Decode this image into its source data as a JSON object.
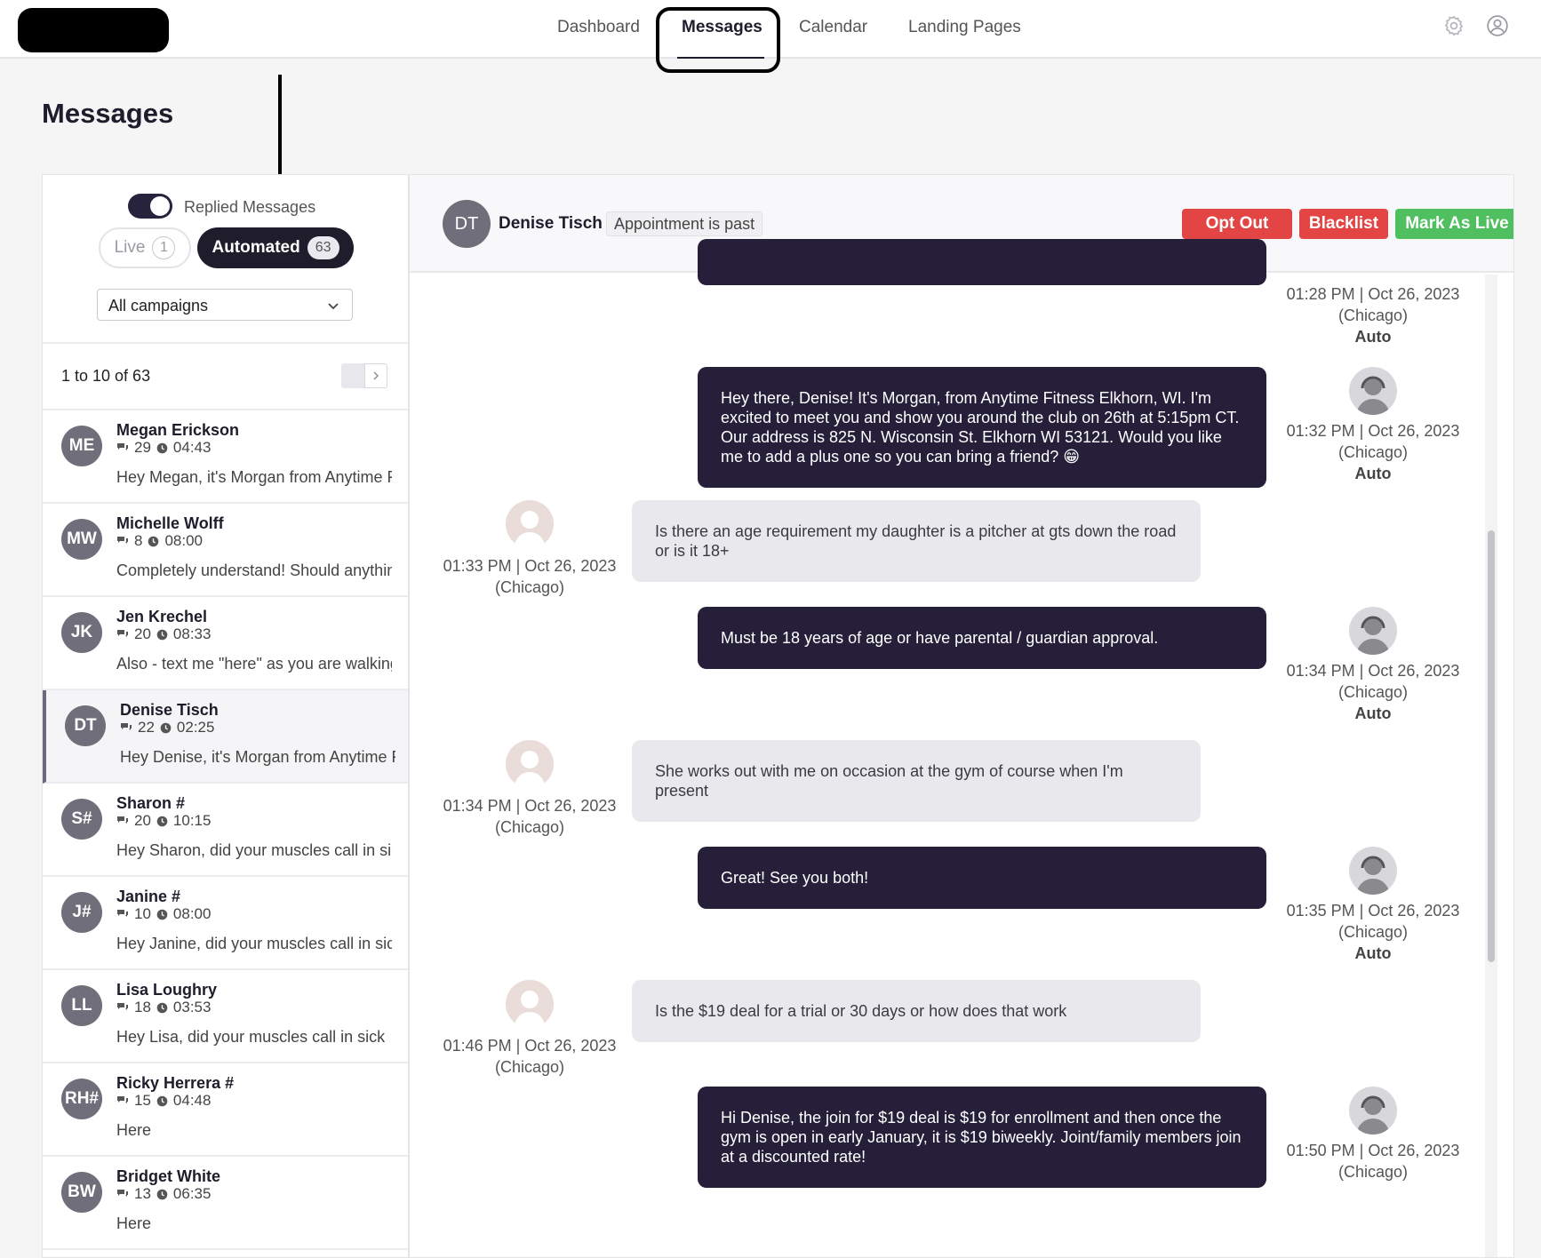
{
  "nav": {
    "items": [
      {
        "label": "Dashboard",
        "active": false
      },
      {
        "label": "Messages",
        "active": true
      },
      {
        "label": "Calendar",
        "active": false
      },
      {
        "label": "Landing Pages",
        "active": false
      }
    ],
    "icons": [
      "gear-icon",
      "user-circle-icon"
    ]
  },
  "page": {
    "title": "Messages"
  },
  "filters": {
    "toggle_label": "Replied Messages",
    "toggle_on": true,
    "live_label": "Live",
    "live_count": "1",
    "automated_label": "Automated",
    "automated_count": "63",
    "campaign_select": "All campaigns"
  },
  "pager": {
    "text": "1 to 10 of 63"
  },
  "conversations": [
    {
      "initials": "ME",
      "name": "Megan Erickson",
      "count": "29",
      "time": "04:43",
      "preview": "Hey Megan, it's Morgan from Anytime Fitness"
    },
    {
      "initials": "MW",
      "name": "Michelle Wolff",
      "count": "8",
      "time": "08:00",
      "preview": "Completely understand! Should anything change"
    },
    {
      "initials": "JK",
      "name": "Jen Krechel",
      "count": "20",
      "time": "08:33",
      "preview": "Also - text me \"here\" as you are walking in"
    },
    {
      "initials": "DT",
      "name": "Denise Tisch",
      "count": "22",
      "time": "02:25",
      "preview": "Hey Denise, it's Morgan from Anytime Fitness",
      "selected": true
    },
    {
      "initials": "S#",
      "name": "Sharon #",
      "count": "20",
      "time": "10:15",
      "preview": "Hey Sharon, did your muscles call in sick"
    },
    {
      "initials": "J#",
      "name": "Janine #",
      "count": "10",
      "time": "08:00",
      "preview": "Hey Janine, did your muscles call in sick"
    },
    {
      "initials": "LL",
      "name": "Lisa Loughry",
      "count": "18",
      "time": "03:53",
      "preview": "Hey Lisa, did your muscles call in sick"
    },
    {
      "initials": "RH#",
      "name": "Ricky Herrera #",
      "count": "15",
      "time": "04:48",
      "preview": "Here"
    },
    {
      "initials": "BW",
      "name": "Bridget White",
      "count": "13",
      "time": "06:35",
      "preview": "Here"
    }
  ],
  "active_conversation": {
    "initials": "DT",
    "name": "Denise Tisch",
    "status": "Appointment is past",
    "actions": {
      "opt_out": "Opt Out",
      "blacklist": "Blacklist",
      "mark_live": "Mark As Live"
    }
  },
  "messages": [
    {
      "dir": "out",
      "text": "",
      "time": "01:28 PM | Oct 26, 2023",
      "tz": "(Chicago)",
      "tag": "Auto"
    },
    {
      "dir": "out",
      "text": "Hey there, Denise! It's Morgan, from Anytime Fitness Elkhorn, WI. I'm excited to meet you and show you around the club on 26th at 5:15pm CT. Our address is 825 N. Wisconsin St. Elkhorn WI 53121. Would you like me to add a plus one so you can bring a friend? 😁",
      "time": "01:32 PM | Oct 26, 2023",
      "tz": "(Chicago)",
      "tag": "Auto"
    },
    {
      "dir": "in",
      "text": "Is there an age requirement my daughter is a pitcher at gts down the road or is it 18+",
      "time": "01:33 PM | Oct 26, 2023",
      "tz": "(Chicago)"
    },
    {
      "dir": "out",
      "text": "Must be 18 years of age or have parental / guardian approval.",
      "time": "01:34 PM | Oct 26, 2023",
      "tz": "(Chicago)",
      "tag": "Auto"
    },
    {
      "dir": "in",
      "text": "She works out with me on occasion at the gym of course when I'm present",
      "time": "01:34 PM | Oct 26, 2023",
      "tz": "(Chicago)"
    },
    {
      "dir": "out",
      "text": "Great! See you both!",
      "time": "01:35 PM | Oct 26, 2023",
      "tz": "(Chicago)",
      "tag": "Auto"
    },
    {
      "dir": "in",
      "text": "Is the $19 deal for a trial or 30 days or how does that work",
      "time": "01:46 PM | Oct 26, 2023",
      "tz": "(Chicago)"
    },
    {
      "dir": "out",
      "text": "Hi Denise, the join for $19 deal is $19 for enrollment and then once the gym is open in early January, it is $19 biweekly. Joint/family members join at a discounted rate!",
      "time": "01:50 PM | Oct 26, 2023",
      "tz": "(Chicago)"
    }
  ]
}
